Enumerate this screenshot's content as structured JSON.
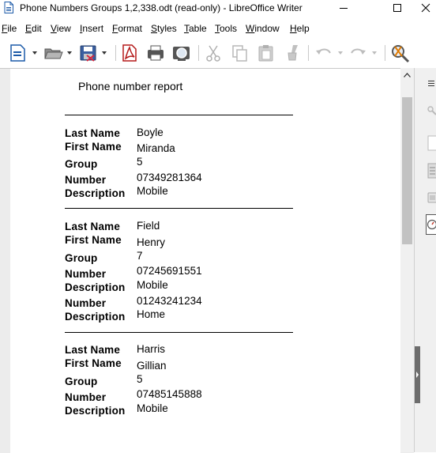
{
  "window": {
    "title": "Phone Numbers Groups 1,2,338.odt (read-only) - LibreOffice Writer"
  },
  "menu": [
    "File",
    "Edit",
    "View",
    "Insert",
    "Format",
    "Styles",
    "Table",
    "Tools",
    "Window",
    "Help"
  ],
  "toolbar": {
    "icons": [
      "new-document-icon",
      "open-folder-icon",
      "save-icon",
      "export-pdf-icon",
      "print-icon",
      "print-preview-icon",
      "cut-icon",
      "copy-icon",
      "paste-icon",
      "clone-formatting-icon",
      "undo-icon",
      "redo-icon",
      "find-replace-icon"
    ]
  },
  "document": {
    "title": "Phone number report",
    "labels": {
      "last_name": "Last Name",
      "first_name": "First Name",
      "group": "Group",
      "number": "Number",
      "description": "Description"
    },
    "records": [
      {
        "last_name": "Boyle",
        "first_name": "Miranda",
        "group": "5",
        "phones": [
          {
            "number": "07349281364",
            "description": "Mobile"
          }
        ]
      },
      {
        "last_name": "Field",
        "first_name": "Henry",
        "group": "7",
        "phones": [
          {
            "number": "07245691551",
            "description": "Mobile"
          },
          {
            "number": "01243241234",
            "description": "Home"
          }
        ]
      },
      {
        "last_name": "Harris",
        "first_name": "Gillian",
        "group": "5",
        "phones": [
          {
            "number": "07485145888",
            "description": "Mobile"
          }
        ]
      }
    ]
  }
}
